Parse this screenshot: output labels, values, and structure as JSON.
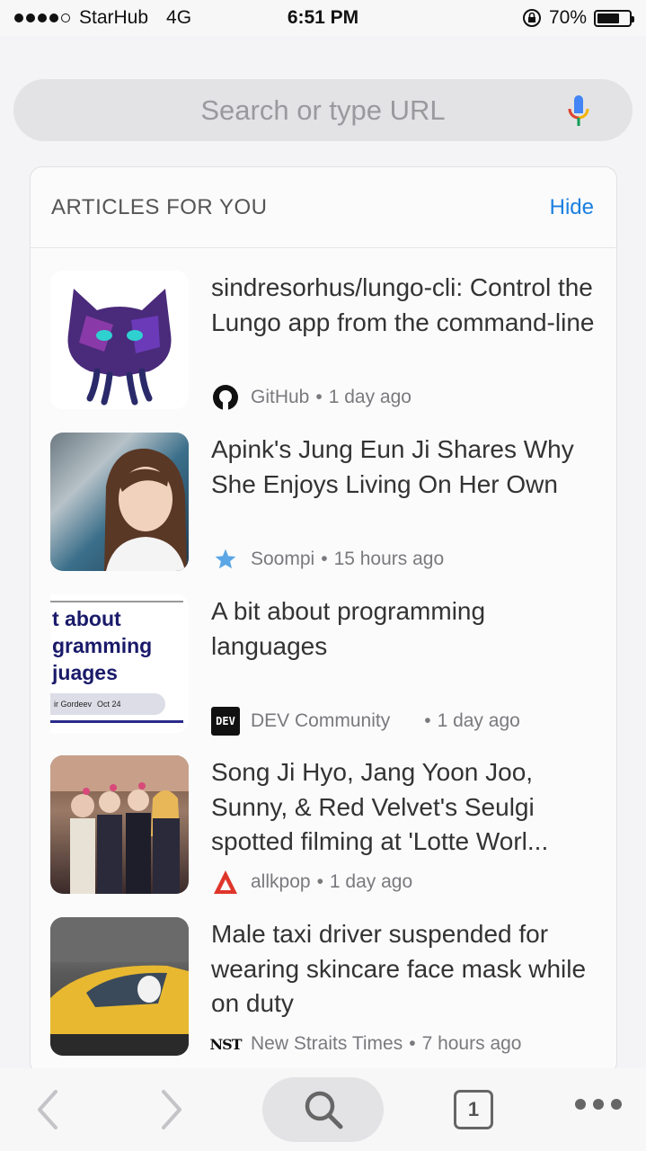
{
  "status_bar": {
    "carrier": "StarHub",
    "network": "4G",
    "time": "6:51 PM",
    "battery_percent": "70%",
    "battery_level": 0.7
  },
  "url_bar": {
    "placeholder": "Search or type URL",
    "mic_icon": "microphone-icon"
  },
  "articles_card": {
    "title": "ARTICLES FOR YOU",
    "hide_label": "Hide",
    "articles": [
      {
        "headline": "sindresorhus/lungo-cli: Control the Lungo app from the command-line",
        "source": "GitHub",
        "separator": "•",
        "age": "1 day ago",
        "source_icon": "github-icon"
      },
      {
        "headline": "Apink's Jung Eun Ji Shares Why She Enjoys Living On Her Own",
        "source": "Soompi",
        "separator": "•",
        "age": "15 hours ago",
        "source_icon": "star-icon"
      },
      {
        "headline": "A bit about programming languages",
        "source": "DEV Community",
        "separator": "•",
        "age": "1 day ago",
        "source_icon": "dev-icon",
        "thumb_text": [
          "t about",
          "gramming",
          "juages"
        ],
        "thumb_byline": "ir Gordeev",
        "thumb_date": "Oct 24"
      },
      {
        "headline": "Song Ji Hyo, Jang Yoon Joo, Sunny, & Red Velvet's Seulgi spotted filming at 'Lotte Worl...",
        "source": "allkpop",
        "separator": "•",
        "age": "1 day ago",
        "source_icon": "allkpop-icon"
      },
      {
        "headline": "Male taxi driver suspended for wearing skincare face mask while on duty",
        "source": "New Straits Times",
        "separator": "•",
        "age": "7 hours ago",
        "source_icon": "nst-icon",
        "source_icon_text": "NST"
      }
    ]
  },
  "toolbar": {
    "tab_count": "1"
  },
  "colors": {
    "accent": "#1a7fe0",
    "background": "#f4f4f6"
  }
}
